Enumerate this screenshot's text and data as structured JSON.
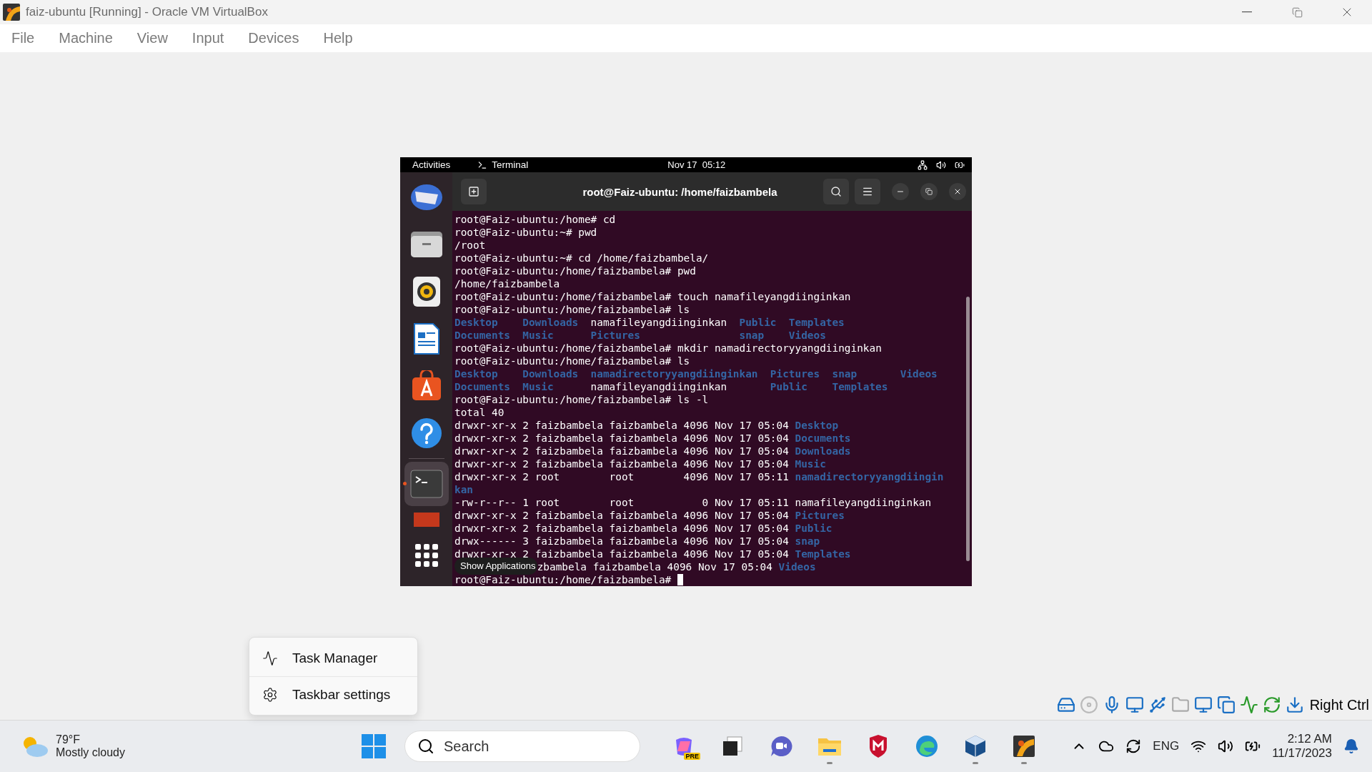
{
  "window": {
    "title": "faiz-ubuntu [Running] - Oracle VM VirtualBox"
  },
  "menu": [
    "File",
    "Machine",
    "View",
    "Input",
    "Devices",
    "Help"
  ],
  "guest": {
    "top_bar": {
      "activities": "Activities",
      "app": "Terminal",
      "clock": "Nov 17  05:12"
    },
    "dock": {
      "items": [
        {
          "kind": "mail",
          "running": false
        },
        {
          "kind": "files",
          "running": false
        },
        {
          "kind": "music",
          "running": false
        },
        {
          "kind": "writer",
          "running": false
        },
        {
          "kind": "store",
          "running": false
        },
        {
          "kind": "help",
          "running": false
        },
        {
          "kind": "terminal",
          "running": true
        },
        {
          "kind": "partial",
          "running": false
        },
        {
          "kind": "apps",
          "running": false
        }
      ],
      "tooltip": "Show Applications"
    },
    "terminal": {
      "title": "root@Faiz-ubuntu: /home/faizbambela",
      "lines": [
        [
          {
            "text": "root@Faiz-ubuntu:/home# cd",
            "kind": "plain"
          }
        ],
        [
          {
            "text": "root@Faiz-ubuntu:~# pwd",
            "kind": "plain"
          }
        ],
        [
          {
            "text": "/root",
            "kind": "plain"
          }
        ],
        [
          {
            "text": "root@Faiz-ubuntu:~# cd /home/faizbambela/",
            "kind": "plain"
          }
        ],
        [
          {
            "text": "root@Faiz-ubuntu:/home/faizbambela# pwd",
            "kind": "plain"
          }
        ],
        [
          {
            "text": "/home/faizbambela",
            "kind": "plain"
          }
        ],
        [
          {
            "text": "root@Faiz-ubuntu:/home/faizbambela# touch namafileyangdiinginkan",
            "kind": "plain"
          }
        ],
        [
          {
            "text": "root@Faiz-ubuntu:/home/faizbambela# ls",
            "kind": "plain"
          }
        ],
        [
          {
            "kind": "listing",
            "rows": [
              [
                {
                  "text": "Desktop",
                  "kind": "dir"
                },
                {
                  "text": "Downloads",
                  "kind": "dir"
                },
                {
                  "text": "namafileyangdiinginkan",
                  "kind": "plain"
                },
                {
                  "text": "Public",
                  "kind": "dir"
                },
                {
                  "text": "Templates",
                  "kind": "dir"
                }
              ],
              [
                {
                  "text": "Documents",
                  "kind": "dir"
                },
                {
                  "text": "Music",
                  "kind": "dir"
                },
                {
                  "text": "Pictures",
                  "kind": "dir"
                },
                {
                  "text": "snap",
                  "kind": "dir"
                },
                {
                  "text": "Videos",
                  "kind": "dir"
                }
              ]
            ]
          }
        ],
        [
          {
            "text": "root@Faiz-ubuntu:/home/faizbambela# mkdir namadirectoryyangdiinginkan",
            "kind": "plain"
          }
        ],
        [
          {
            "text": "root@Faiz-ubuntu:/home/faizbambela# ls",
            "kind": "plain"
          }
        ],
        [
          {
            "kind": "listing",
            "rows": [
              [
                {
                  "text": "Desktop",
                  "kind": "dir"
                },
                {
                  "text": "Downloads",
                  "kind": "dir"
                },
                {
                  "text": "namadirectoryyangdiinginkan",
                  "kind": "dir"
                },
                {
                  "text": "Pictures",
                  "kind": "dir"
                },
                {
                  "text": "snap",
                  "kind": "dir"
                },
                {
                  "text": "Videos",
                  "kind": "dir"
                }
              ],
              [
                {
                  "text": "Documents",
                  "kind": "dir"
                },
                {
                  "text": "Music",
                  "kind": "dir"
                },
                {
                  "text": "namafileyangdiinginkan",
                  "kind": "plain"
                },
                {
                  "text": "Public",
                  "kind": "dir"
                },
                {
                  "text": "Templates",
                  "kind": "dir"
                }
              ]
            ]
          }
        ],
        [
          {
            "text": "root@Faiz-ubuntu:/home/faizbambela# ls -l",
            "kind": "plain"
          }
        ],
        [
          {
            "text": "total 40",
            "kind": "plain"
          }
        ],
        [
          {
            "text": "drwxr-xr-x 2 faizbambela faizbambela 4096 Nov 17 05:04 ",
            "kind": "plain"
          },
          {
            "text": "Desktop",
            "kind": "dir"
          }
        ],
        [
          {
            "text": "drwxr-xr-x 2 faizbambela faizbambela 4096 Nov 17 05:04 ",
            "kind": "plain"
          },
          {
            "text": "Documents",
            "kind": "dir"
          }
        ],
        [
          {
            "text": "drwxr-xr-x 2 faizbambela faizbambela 4096 Nov 17 05:04 ",
            "kind": "plain"
          },
          {
            "text": "Downloads",
            "kind": "dir"
          }
        ],
        [
          {
            "text": "drwxr-xr-x 2 faizbambela faizbambela 4096 Nov 17 05:04 ",
            "kind": "plain"
          },
          {
            "text": "Music",
            "kind": "dir"
          }
        ],
        [
          {
            "text": "drwxr-xr-x 2 root        root        4096 Nov 17 05:11 ",
            "kind": "plain"
          },
          {
            "text": "namadirectoryyangdiingin",
            "kind": "dir"
          }
        ],
        [
          {
            "text": "kan",
            "kind": "dir"
          }
        ],
        [
          {
            "text": "-rw-r--r-- 1 root        root           0 Nov 17 05:11 namafileyangdiinginkan",
            "kind": "plain"
          }
        ],
        [
          {
            "text": "drwxr-xr-x 2 faizbambela faizbambela 4096 Nov 17 05:04 ",
            "kind": "plain"
          },
          {
            "text": "Pictures",
            "kind": "dir"
          }
        ],
        [
          {
            "text": "drwxr-xr-x 2 faizbambela faizbambela 4096 Nov 17 05:04 ",
            "kind": "plain"
          },
          {
            "text": "Public",
            "kind": "dir"
          }
        ],
        [
          {
            "text": "drwx------ 3 faizbambela faizbambela 4096 Nov 17 05:04 ",
            "kind": "plain"
          },
          {
            "text": "snap",
            "kind": "dir"
          }
        ],
        [
          {
            "text": "drwxr-xr-x 2 faizbambela faizbambela 4096 Nov 17 05:04 ",
            "kind": "plain"
          },
          {
            "text": "Templates",
            "kind": "dir"
          }
        ],
        [
          {
            "kind": "tooltip"
          },
          {
            "text": "zbambela faizbambela 4096 Nov 17 05:04 ",
            "kind": "plain"
          },
          {
            "text": "Videos",
            "kind": "dir"
          }
        ],
        [
          {
            "text": "root@Faiz-ubuntu:/home/faizbambela# ",
            "kind": "prompt"
          }
        ]
      ]
    }
  },
  "status_bar": {
    "host_key": "Right Ctrl"
  },
  "context_menu": [
    {
      "kind": "task-manager",
      "label": "Task Manager"
    },
    {
      "kind": "settings",
      "label": "Taskbar settings"
    }
  ],
  "taskbar": {
    "weather": {
      "temp": "79°F",
      "condition": "Mostly cloudy"
    },
    "search": {
      "placeholder": "Search"
    },
    "apps": [
      {
        "kind": "copilot",
        "badge": "PRE",
        "running": false
      },
      {
        "kind": "task-view",
        "running": false
      },
      {
        "kind": "chat",
        "running": false
      },
      {
        "kind": "folder",
        "running": true
      },
      {
        "kind": "shield",
        "running": false
      },
      {
        "kind": "browser",
        "running": false
      },
      {
        "kind": "cube",
        "running": true
      },
      {
        "kind": "vbox",
        "running": true
      }
    ],
    "tray": {
      "language": "ENG",
      "time": "2:12 AM",
      "date": "11/17/2023"
    }
  }
}
